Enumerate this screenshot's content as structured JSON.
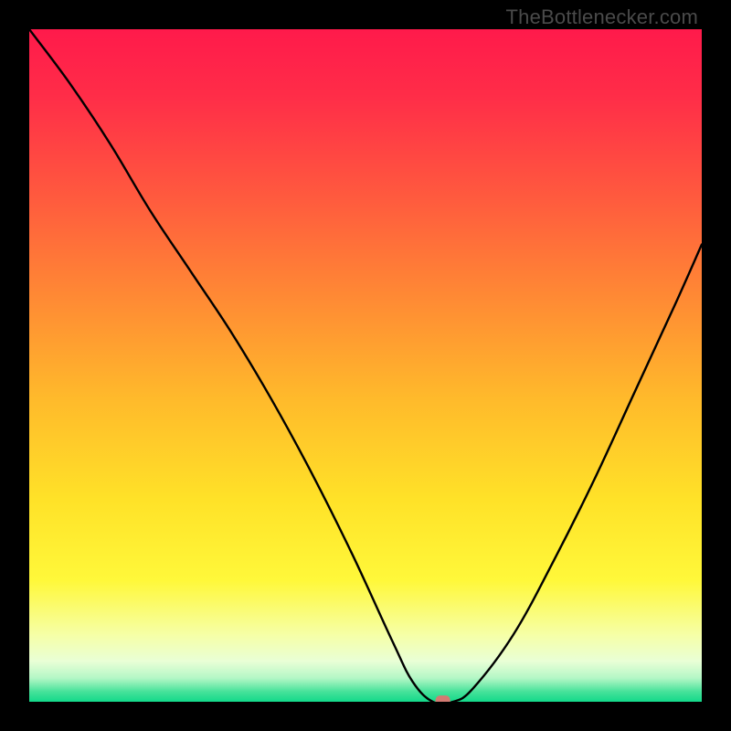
{
  "watermark": "TheBottlenecker.com",
  "chart_data": {
    "type": "line",
    "title": "",
    "xlabel": "",
    "ylabel": "",
    "xlim": [
      0,
      100
    ],
    "ylim": [
      0,
      100
    ],
    "x": [
      0,
      6,
      12,
      18,
      24,
      30,
      36,
      42,
      48,
      54,
      57,
      60,
      63,
      66,
      72,
      78,
      84,
      90,
      96,
      100
    ],
    "values": [
      100,
      92,
      83,
      73,
      64,
      55,
      45,
      34,
      22,
      9,
      3,
      0,
      0,
      2,
      10,
      21,
      33,
      46,
      59,
      68
    ],
    "marker": {
      "x": 61.5,
      "y": 0,
      "width": 2.2,
      "height": 1.6,
      "color": "#d37a72"
    },
    "gradient_stops": [
      {
        "offset": 0.0,
        "color": "#ff1a4b"
      },
      {
        "offset": 0.1,
        "color": "#ff2d48"
      },
      {
        "offset": 0.25,
        "color": "#ff5a3e"
      },
      {
        "offset": 0.4,
        "color": "#ff8a34"
      },
      {
        "offset": 0.55,
        "color": "#ffba2b"
      },
      {
        "offset": 0.7,
        "color": "#ffe228"
      },
      {
        "offset": 0.82,
        "color": "#fff83a"
      },
      {
        "offset": 0.9,
        "color": "#f6ffa6"
      },
      {
        "offset": 0.94,
        "color": "#e9ffd6"
      },
      {
        "offset": 0.965,
        "color": "#b3f7c6"
      },
      {
        "offset": 0.985,
        "color": "#46e29a"
      },
      {
        "offset": 1.0,
        "color": "#13d98a"
      }
    ]
  }
}
